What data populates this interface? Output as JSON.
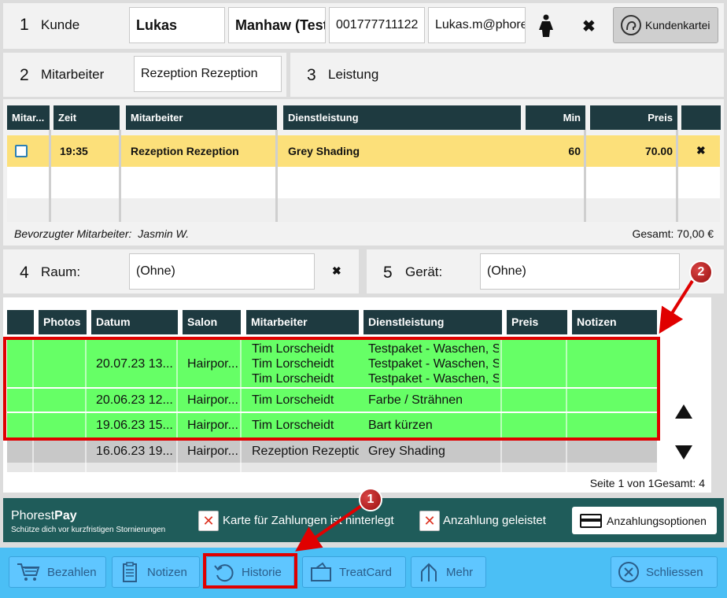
{
  "kunde": {
    "num": "1",
    "label": "Kunde",
    "firstname": "Lukas",
    "lastname": "Manhaw (Test)",
    "phone": "001777711122",
    "email": "Lukas.m@phorest.com",
    "card_button": "Kundenkartei"
  },
  "mitarbeiter": {
    "num": "2",
    "label": "Mitarbeiter",
    "value": "Rezeption Rezeption"
  },
  "leistung": {
    "num": "3",
    "label": "Leistung"
  },
  "services_table": {
    "headers": [
      "Mitar...",
      "Zeit",
      "Mitarbeiter",
      "Dienstleistung",
      "Min",
      "Preis"
    ],
    "row": {
      "zeit": "19:35",
      "mitarbeiter": "Rezeption Rezeption",
      "dienstleistung": "Grey Shading",
      "min": "60",
      "preis": "70.00"
    },
    "preferred_label": "Bevorzugter Mitarbeiter:",
    "preferred_value": "Jasmin W.",
    "total": "Gesamt: 70,00 €"
  },
  "raum": {
    "num": "4",
    "label": "Raum:",
    "value": "(Ohne)"
  },
  "geraet": {
    "num": "5",
    "label": "Gerät:",
    "value": "(Ohne)"
  },
  "history_table": {
    "headers": [
      "",
      "Photos",
      "Datum",
      "Salon",
      "Mitarbeiter",
      "Dienstleistung",
      "Preis",
      "Notizen"
    ],
    "rows": [
      {
        "datum": "20.07.23 13...",
        "salon": "Hairpor...",
        "mitarbeiter": "Tim Lorscheidt",
        "dienstleistung": "Testpaket - Waschen, Schneiden"
      },
      {
        "datum": "20.06.23 12...",
        "salon": "Hairpor...",
        "mitarbeiter": "Tim Lorscheidt",
        "dienstleistung": "Farbe / Strähnen"
      },
      {
        "datum": "19.06.23 15...",
        "salon": "Hairpor...",
        "mitarbeiter": "Tim Lorscheidt",
        "dienstleistung": "Bart kürzen"
      },
      {
        "datum": "16.06.23 19...",
        "salon": "Hairpor...",
        "mitarbeiter": "Rezeption Rezeption",
        "dienstleistung": "Grey Shading"
      }
    ],
    "page_info": "Seite 1 von 1Gesamt: 4"
  },
  "pay": {
    "brand_a": "Phorest",
    "brand_b": "Pay",
    "subtitle": "Schütze dich vor kurzfristigen Stornierungen",
    "card_stored": "Karte für Zahlungen ist hinterlegt",
    "deposit": "Anzahlung geleistet",
    "options": "Anzahlungsoptionen"
  },
  "toolbar": {
    "bezahlen": "Bezahlen",
    "notizen": "Notizen",
    "historie": "Historie",
    "treatcard": "TreatCard",
    "mehr": "Mehr",
    "schliessen": "Schliessen"
  },
  "annotations": {
    "one": "1",
    "two": "2"
  },
  "colors": {
    "header": "#1e3a40",
    "highlight_row": "#fce07a",
    "history_green": "#66ff66",
    "red_annotation": "#e00000",
    "toolbar": "#4bbff5",
    "pay_bar": "#1f5c5a"
  }
}
